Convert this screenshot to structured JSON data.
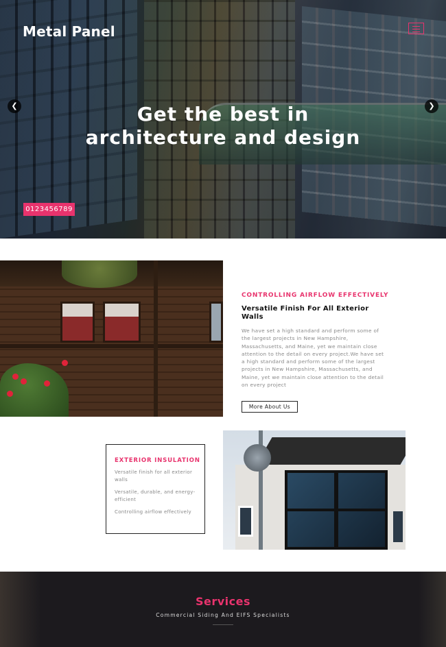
{
  "header": {
    "logo": "Metal Panel",
    "menu_icon": "hamburger-icon"
  },
  "hero": {
    "title_line1": "Get the best in",
    "title_line2": "architecture and design",
    "phone": "0123456789",
    "prev_icon": "chevron-left-icon",
    "next_icon": "chevron-right-icon"
  },
  "feature": {
    "kicker": "CONTROLLING AIRFLOW EFFECTIVELY",
    "heading": "Versatile Finish For All Exterior Walls",
    "paragraph": "We have set a high standard and perform some of the largest projects in New Hampshire, Massachusetts, and Maine, yet we maintain close attention to the detail on every project.We have set a high standard and perform some of the largest projects in New Hampshire, Massachusetts, and Maine, yet we maintain close attention to the detail on every project",
    "button": "More About Us"
  },
  "insulation": {
    "title": "EXTERIOR INSULATION",
    "items": [
      "Versatile finish for all exterior walls",
      "Versatile, durable, and energy-efficient",
      "Controlling airflow effectively"
    ]
  },
  "services": {
    "title": "Services",
    "subtitle": "Commercial Siding And EIFS Specialists"
  },
  "colors": {
    "accent": "#e8336d",
    "dark": "#1c1a1e"
  }
}
